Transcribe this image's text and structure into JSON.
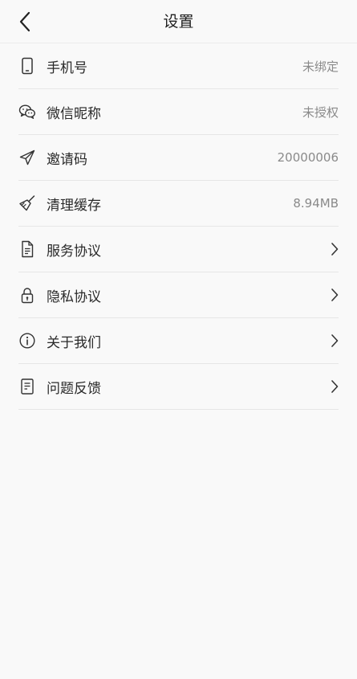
{
  "header": {
    "title": "设置"
  },
  "settings": {
    "phone": {
      "label": "手机号",
      "value": "未绑定",
      "icon": "phone-icon"
    },
    "wechat": {
      "label": "微信昵称",
      "value": "未授权",
      "icon": "wechat-icon"
    },
    "invite": {
      "label": "邀请码",
      "value": "20000006",
      "icon": "paper-plane-icon"
    },
    "cache": {
      "label": "清理缓存",
      "value": "8.94MB",
      "icon": "broom-icon"
    },
    "service": {
      "label": "服务协议",
      "icon": "document-icon"
    },
    "privacy": {
      "label": "隐私协议",
      "icon": "lock-icon"
    },
    "about": {
      "label": "关于我们",
      "icon": "info-icon"
    },
    "feedback": {
      "label": "问题反馈",
      "icon": "feedback-icon"
    }
  }
}
